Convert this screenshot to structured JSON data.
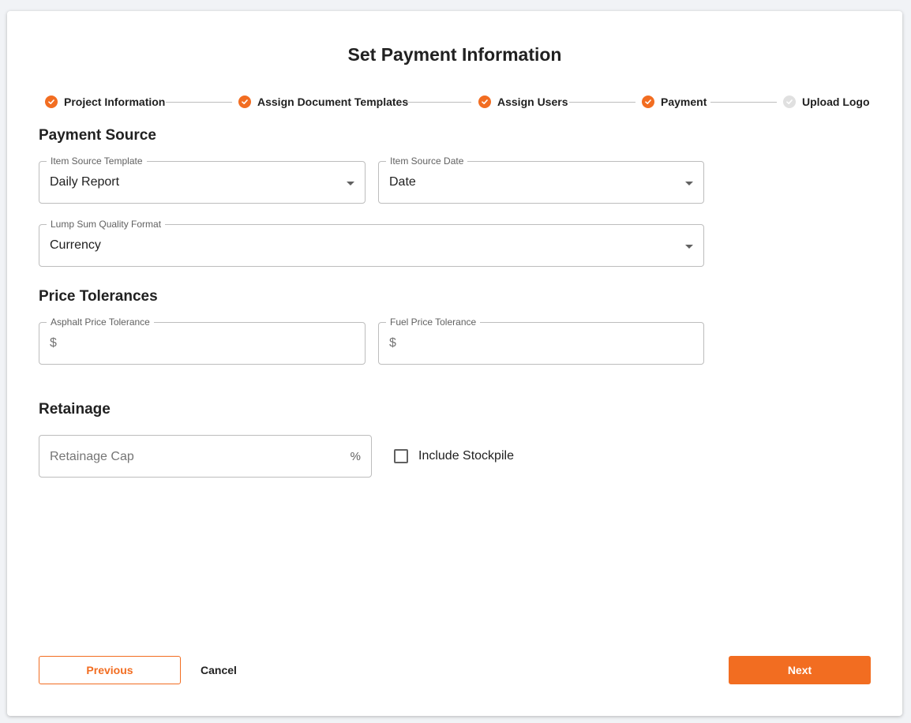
{
  "title": "Set Payment Information",
  "accent_color": "#f26d21",
  "stepper": {
    "steps": [
      {
        "label": "Project Information",
        "status": "complete",
        "icon": "check-circle-icon"
      },
      {
        "label": "Assign Document Templates",
        "status": "complete",
        "icon": "check-circle-icon"
      },
      {
        "label": "Assign Users",
        "status": "complete",
        "icon": "check-circle-icon"
      },
      {
        "label": "Payment",
        "status": "complete",
        "icon": "check-circle-icon"
      },
      {
        "label": "Upload Logo",
        "status": "incomplete",
        "icon": "check-circle-icon"
      }
    ]
  },
  "payment_source": {
    "heading": "Payment Source",
    "item_source_template": {
      "label": "Item Source Template",
      "value": "Daily Report"
    },
    "item_source_date": {
      "label": "Item Source Date",
      "value": "Date"
    },
    "lump_sum_quality_format": {
      "label": "Lump Sum Quality Format",
      "value": "Currency"
    }
  },
  "price_tolerances": {
    "heading": "Price Tolerances",
    "asphalt": {
      "label": "Asphalt Price Tolerance",
      "prefix": "$",
      "value": ""
    },
    "fuel": {
      "label": "Fuel Price Tolerance",
      "prefix": "$",
      "value": ""
    }
  },
  "retainage": {
    "heading": "Retainage",
    "cap": {
      "placeholder": "Retainage Cap",
      "suffix": "%",
      "value": ""
    },
    "include_stockpile": {
      "label": "Include Stockpile",
      "checked": false
    }
  },
  "buttons": {
    "previous": "Previous",
    "cancel": "Cancel",
    "next": "Next"
  }
}
